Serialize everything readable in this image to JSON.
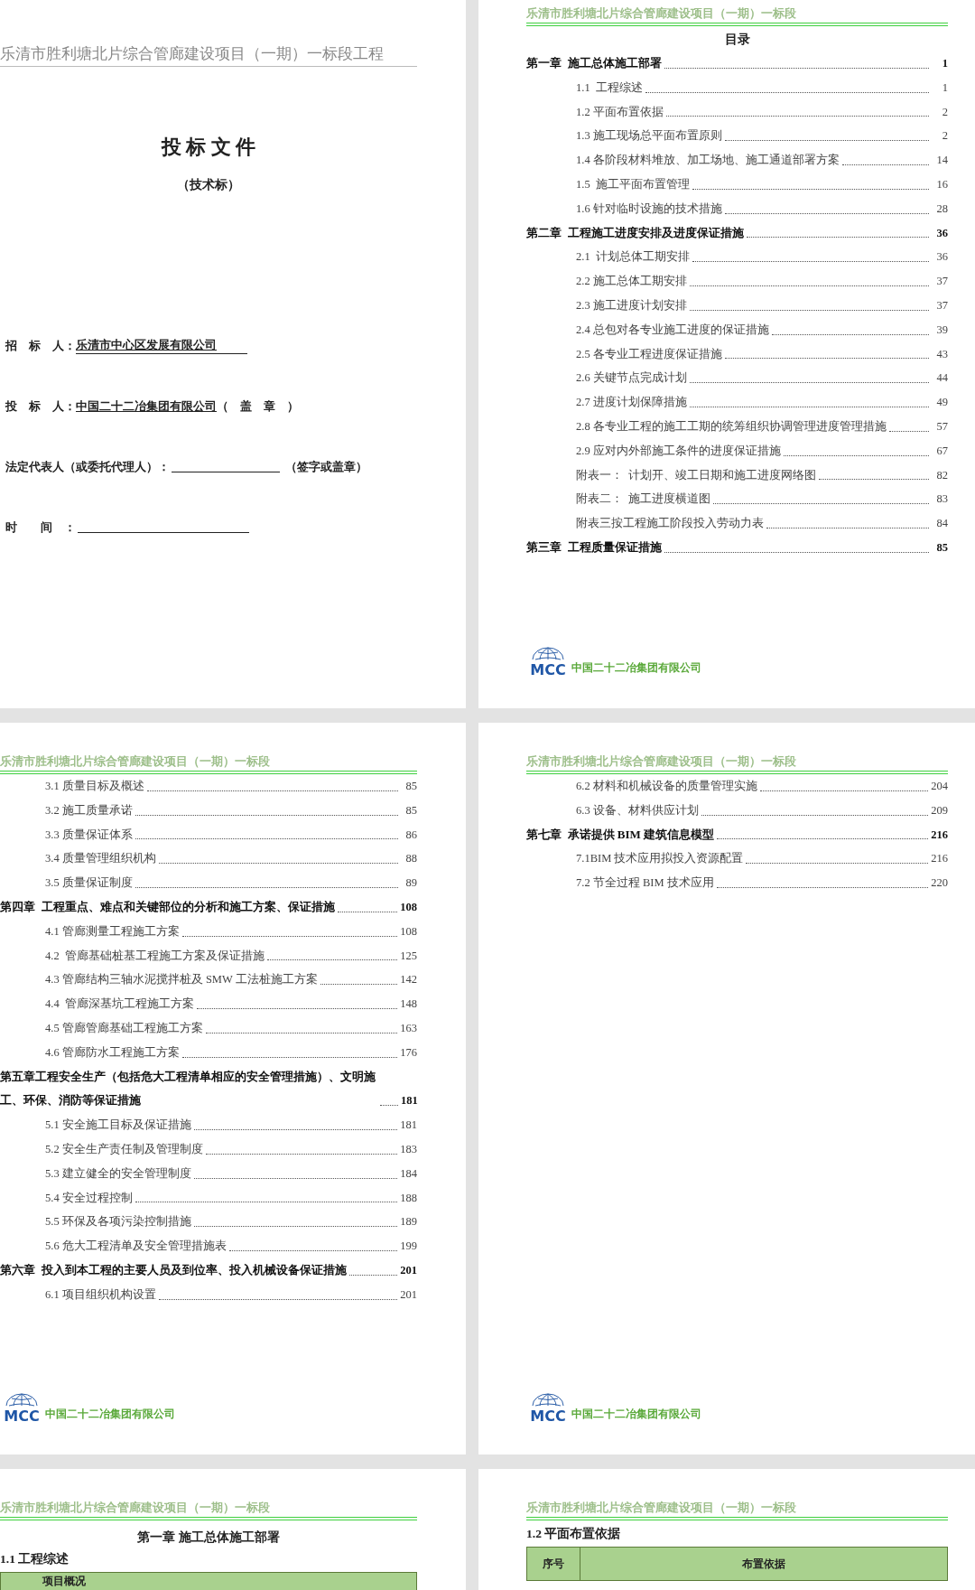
{
  "rows": [
    {
      "pages": [
        {
          "kind": "cover",
          "header": "乐清市胜利塘北片综合管廊建设项目（一期）一标段工程",
          "title": "投 标 文 件",
          "subtitle": "（技术标）",
          "fields": [
            {
              "kind": "filled",
              "label": "招　标　人：",
              "value": "乐清市中心区发展有限公司"
            },
            {
              "kind": "filled",
              "label": "投　标　人：",
              "value": "中国二十二冶集团有限公司",
              "suffix": "（　盖　章　）"
            },
            {
              "kind": "blank",
              "label": "法定代表人（或委托代理人）：",
              "suffix": "（签字或盖章）"
            },
            {
              "kind": "blank",
              "label": "时　　间　："
            }
          ]
        },
        {
          "kind": "toc",
          "header": "乐清市胜利塘北片综合管廊建设项目（一期）一标段",
          "heading": "目录",
          "logo": "MCC",
          "company": "中国二十二冶集团有限公司",
          "entries": [
            {
              "kind": "chapter",
              "text": "第一章  施工总体施工部署",
              "page": "1"
            },
            {
              "kind": "section",
              "text": "1.1  工程综述",
              "page": "1"
            },
            {
              "kind": "section",
              "text": "1.2 平面布置依据",
              "page": "2"
            },
            {
              "kind": "section",
              "text": "1.3 施工现场总平面布置原则",
              "page": "2"
            },
            {
              "kind": "section",
              "text": "1.4 各阶段材料堆放、加工场地、施工通道部署方案",
              "page": "14"
            },
            {
              "kind": "section",
              "text": "1.5  施工平面布置管理",
              "page": "16"
            },
            {
              "kind": "section",
              "text": "1.6 针对临时设施的技术措施",
              "page": "28"
            },
            {
              "kind": "chapter",
              "text": "第二章  工程施工进度安排及进度保证措施",
              "page": "36"
            },
            {
              "kind": "section",
              "text": "2.1  计划总体工期安排",
              "page": "36"
            },
            {
              "kind": "section",
              "text": "2.2 施工总体工期安排",
              "page": "37"
            },
            {
              "kind": "section",
              "text": "2.3 施工进度计划安排",
              "page": "37"
            },
            {
              "kind": "section",
              "text": "2.4 总包对各专业施工进度的保证措施",
              "page": "39"
            },
            {
              "kind": "section",
              "text": "2.5 各专业工程进度保证措施",
              "page": "43"
            },
            {
              "kind": "section",
              "text": "2.6 关键节点完成计划",
              "page": "44"
            },
            {
              "kind": "section",
              "text": "2.7 进度计划保障措施",
              "page": "49"
            },
            {
              "kind": "section",
              "text": "2.8 各专业工程的施工工期的统筹组织协调管理进度管理措施",
              "page": "57"
            },
            {
              "kind": "section",
              "text": "2.9 应对内外部施工条件的进度保证措施",
              "page": "67"
            },
            {
              "kind": "section",
              "text": "附表一：  计划开、竣工日期和施工进度网络图",
              "page": "82"
            },
            {
              "kind": "section",
              "text": "附表二：  施工进度横道图",
              "page": "83"
            },
            {
              "kind": "section",
              "text": "附表三按工程施工阶段投入劳动力表",
              "page": "84"
            },
            {
              "kind": "chapter",
              "text": "第三章  工程质量保证措施",
              "page": "85"
            }
          ]
        }
      ]
    },
    {
      "pages": [
        {
          "kind": "toc",
          "header": "乐清市胜利塘北片综合管廊建设项目（一期）一标段",
          "logo": "MCC",
          "company": "中国二十二冶集团有限公司",
          "entries": [
            {
              "kind": "section",
              "text": "3.1 质量目标及概述",
              "page": "85"
            },
            {
              "kind": "section",
              "text": "3.2 施工质量承诺",
              "page": "85"
            },
            {
              "kind": "section",
              "text": "3.3 质量保证体系",
              "page": "86"
            },
            {
              "kind": "section",
              "text": "3.4 质量管理组织机构",
              "page": "88"
            },
            {
              "kind": "section",
              "text": "3.5 质量保证制度",
              "page": "89"
            },
            {
              "kind": "chapter",
              "text": "第四章  工程重点、难点和关键部位的分析和施工方案、保证措施",
              "page": "108"
            },
            {
              "kind": "section",
              "text": "4.1 管廊测量工程施工方案",
              "page": "108"
            },
            {
              "kind": "section",
              "text": "4.2  管廊基础桩基工程施工方案及保证措施",
              "page": "125"
            },
            {
              "kind": "section",
              "text": "4.3 管廊结构三轴水泥搅拌桩及 SMW 工法桩施工方案",
              "page": "142"
            },
            {
              "kind": "section",
              "text": "4.4  管廊深基坑工程施工方案",
              "page": "148"
            },
            {
              "kind": "section",
              "text": "4.5 管廊管廊基础工程施工方案",
              "page": "163"
            },
            {
              "kind": "section",
              "text": "4.6 管廊防水工程施工方案",
              "page": "176"
            },
            {
              "kind": "chapter",
              "text": "第五章工程安全生产（包括危大工程清单相应的安全管理措施）、文明施工、环保、消防等保证措施",
              "page": "181"
            },
            {
              "kind": "section",
              "text": "5.1 安全施工目标及保证措施",
              "page": "181"
            },
            {
              "kind": "section",
              "text": "5.2 安全生产责任制及管理制度",
              "page": "183"
            },
            {
              "kind": "section",
              "text": "5.3 建立健全的安全管理制度",
              "page": "184"
            },
            {
              "kind": "section",
              "text": "5.4 安全过程控制",
              "page": "188"
            },
            {
              "kind": "section",
              "text": "5.5 环保及各项污染控制措施",
              "page": "189"
            },
            {
              "kind": "section",
              "text": "5.6 危大工程清单及安全管理措施表",
              "page": "199"
            },
            {
              "kind": "chapter",
              "text": "第六章  投入到本工程的主要人员及到位率、投入机械设备保证措施",
              "page": "201"
            },
            {
              "kind": "section",
              "text": "6.1 项目组织机构设置",
              "page": "201"
            }
          ]
        },
        {
          "kind": "toc",
          "header": "乐清市胜利塘北片综合管廊建设项目（一期）一标段",
          "logo": "MCC",
          "company": "中国二十二冶集团有限公司",
          "entries": [
            {
              "kind": "section",
              "text": "6.2 材料和机械设备的质量管理实施",
              "page": "204"
            },
            {
              "kind": "section",
              "text": "6.3 设备、材料供应计划",
              "page": "209"
            },
            {
              "kind": "chapter",
              "text": "第七章  承诺提供 BIM 建筑信息模型",
              "page": "216"
            },
            {
              "kind": "section",
              "text": "7.1BIM 技术应用拟投入资源配置",
              "page": "216"
            },
            {
              "kind": "section",
              "text": "7.2 节全过程 BIM 技术应用",
              "page": "220"
            }
          ]
        }
      ]
    },
    {
      "pages": [
        {
          "kind": "body",
          "header": "乐清市胜利塘北片综合管廊建设项目（一期）一标段",
          "heading": "第一章  施工总体施工部署",
          "subheading": "1.1  工程综述",
          "table": {
            "columns": [
              "项目概况"
            ]
          }
        },
        {
          "kind": "body",
          "header": "乐清市胜利塘北片综合管廊建设项目（一期）一标段",
          "subheading": "1.2 平面布置依据",
          "table": {
            "columns": [
              "序号",
              "布置依据"
            ]
          }
        }
      ]
    }
  ]
}
